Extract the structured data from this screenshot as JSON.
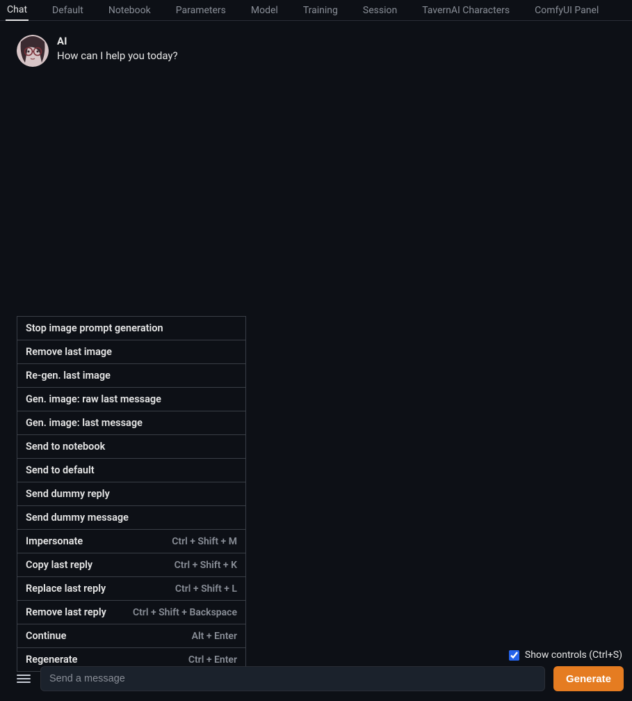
{
  "tabs": [
    {
      "label": "Chat",
      "active": true
    },
    {
      "label": "Default",
      "active": false
    },
    {
      "label": "Notebook",
      "active": false
    },
    {
      "label": "Parameters",
      "active": false
    },
    {
      "label": "Model",
      "active": false
    },
    {
      "label": "Training",
      "active": false
    },
    {
      "label": "Session",
      "active": false
    },
    {
      "label": "TavernAI Characters",
      "active": false
    },
    {
      "label": "ComfyUI Panel",
      "active": false
    }
  ],
  "message": {
    "author": "AI",
    "text": "How can I help you today?"
  },
  "menu": [
    {
      "label": "Stop image prompt generation",
      "shortcut": ""
    },
    {
      "label": "Remove last image",
      "shortcut": ""
    },
    {
      "label": "Re-gen. last image",
      "shortcut": ""
    },
    {
      "label": "Gen. image: raw last message",
      "shortcut": ""
    },
    {
      "label": "Gen. image: last message",
      "shortcut": ""
    },
    {
      "label": "Send to notebook",
      "shortcut": ""
    },
    {
      "label": "Send to default",
      "shortcut": ""
    },
    {
      "label": "Send dummy reply",
      "shortcut": ""
    },
    {
      "label": "Send dummy message",
      "shortcut": ""
    },
    {
      "label": "Impersonate",
      "shortcut": "Ctrl + Shift + M"
    },
    {
      "label": "Copy last reply",
      "shortcut": "Ctrl + Shift + K"
    },
    {
      "label": "Replace last reply",
      "shortcut": "Ctrl + Shift + L"
    },
    {
      "label": "Remove last reply",
      "shortcut": "Ctrl + Shift + Backspace"
    },
    {
      "label": "Continue",
      "shortcut": "Alt + Enter"
    },
    {
      "label": "Regenerate",
      "shortcut": "Ctrl + Enter"
    }
  ],
  "controls": {
    "show_controls_label": "Show controls (Ctrl+S)",
    "show_controls_checked": true,
    "input_placeholder": "Send a message",
    "generate_label": "Generate"
  }
}
